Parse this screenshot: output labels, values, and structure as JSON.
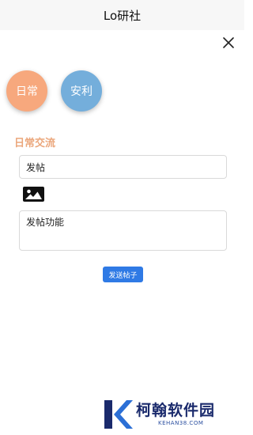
{
  "app": {
    "title": "Lo研社"
  },
  "colors": {
    "daily": "#f7a87d",
    "welfare": "#74aedb",
    "section_title": "#eba77c",
    "send_button": "#2f7ae5"
  },
  "categories": [
    {
      "label": "日常"
    },
    {
      "label": "安利"
    }
  ],
  "section": {
    "title": "日常交流"
  },
  "form": {
    "title_value": "发帖",
    "content_value": "发帖功能",
    "send_label": "发送帖子"
  },
  "icons": {
    "close": "close-icon",
    "image": "image-icon"
  },
  "watermark": {
    "name": "柯翰软件园",
    "url": "KEHAN38.COM"
  }
}
